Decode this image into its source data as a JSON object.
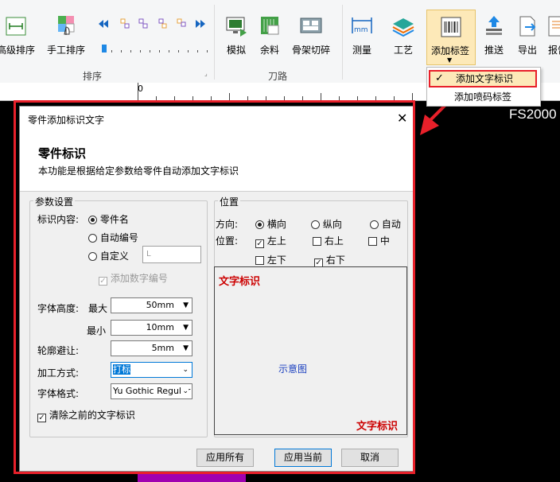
{
  "ribbon": {
    "sort_group": {
      "label": "排序",
      "items": [
        {
          "label": "高级排序",
          "icon": "advanced-sort-icon"
        },
        {
          "label": "手工排序",
          "icon": "manual-sort-icon"
        }
      ],
      "slider_icons": [
        "prev-icon",
        "sort-style-1-icon",
        "sort-style-2-icon",
        "sort-style-3-icon",
        "sort-style-4-icon",
        "next-icon"
      ]
    },
    "toolpath_group": {
      "label": "刀路",
      "items": [
        {
          "label": "模拟",
          "icon": "simulate-icon"
        },
        {
          "label": "余料",
          "icon": "remnant-icon"
        },
        {
          "label": "骨架切碎",
          "icon": "skeleton-cut-icon"
        }
      ]
    },
    "other_items": [
      {
        "label": "测量",
        "icon": "measure-icon"
      },
      {
        "label": "工艺",
        "icon": "process-icon"
      },
      {
        "label": "添加标签",
        "icon": "add-label-icon",
        "has_dropdown": true
      },
      {
        "label": "推送",
        "icon": "push-icon"
      },
      {
        "label": "导出",
        "icon": "export-icon"
      },
      {
        "label": "报告",
        "icon": "report-icon"
      }
    ]
  },
  "ruler": {
    "mark": "0"
  },
  "canvas": {
    "part_text": "FS2000"
  },
  "dropdown": {
    "items": [
      {
        "label": "添加文字标识",
        "checked": true
      },
      {
        "label": "添加喷码标签",
        "checked": false
      }
    ]
  },
  "dialog": {
    "title": "零件添加标识文字",
    "heading": "零件标识",
    "description": "本功能是根据给定参数给零件自动添加文字标识",
    "params": {
      "legend": "参数设置",
      "content_label": "标识内容:",
      "options": [
        "零件名",
        "自动编号",
        "自定义"
      ],
      "custom_value": "L",
      "add_number_label": "添加数字编号",
      "font_height_label": "字体高度:",
      "max_label": "最大",
      "max_value": "50mm",
      "min_label": "最小",
      "min_value": "10mm",
      "contour_label": "轮廓避让:",
      "contour_value": "5mm",
      "method_label": "加工方式:",
      "method_value": "打标",
      "font_label": "字体格式:",
      "font_value": "Yu Gothic Regular",
      "clear_label": "清除之前的文字标识"
    },
    "position": {
      "legend": "位置",
      "direction_label": "方向:",
      "directions": [
        "横向",
        "纵向",
        "自动"
      ],
      "position_label": "位置:",
      "positions": [
        "左上",
        "右上",
        "中",
        "左下",
        "右下"
      ],
      "preview_text": "文字标识",
      "preview_caption": "示意图"
    },
    "buttons": {
      "apply_all": "应用所有",
      "apply_current": "应用当前",
      "cancel": "取消"
    }
  },
  "colors": {
    "highlight": "#e8202a",
    "preview_text": "#cc0000",
    "accent": "#0078d7"
  }
}
